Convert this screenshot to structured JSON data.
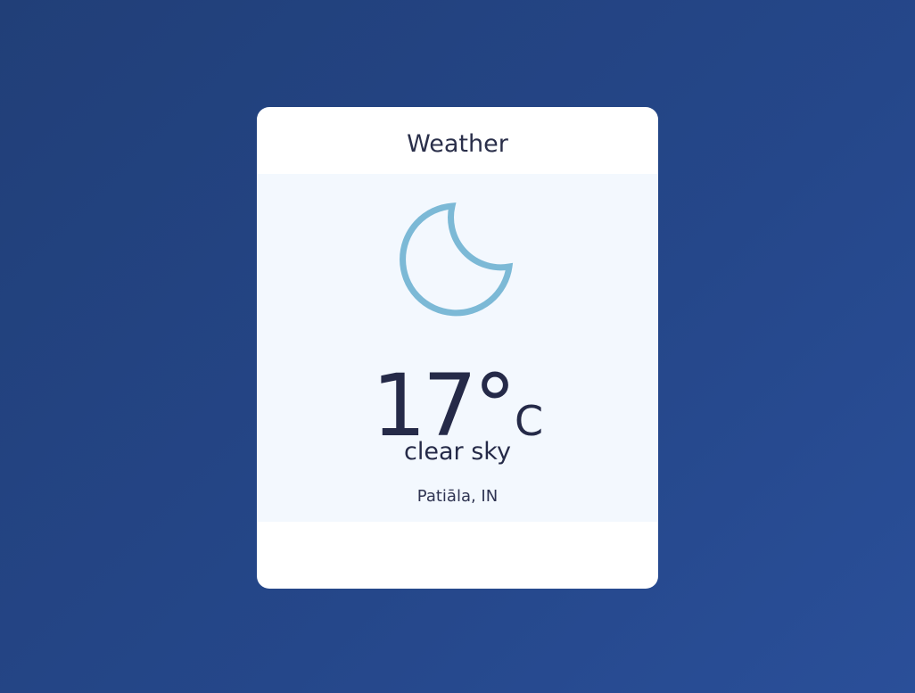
{
  "card": {
    "title": "Weather"
  },
  "weather": {
    "icon": "moon-icon",
    "temperature": "17°",
    "unit": "C",
    "condition": "clear sky",
    "location": "Patiāla, IN"
  },
  "colors": {
    "background": "#24468a",
    "card": "#ffffff",
    "panel": "#f3f8fe",
    "icon": "#7cb9d6",
    "text": "#252a48"
  }
}
